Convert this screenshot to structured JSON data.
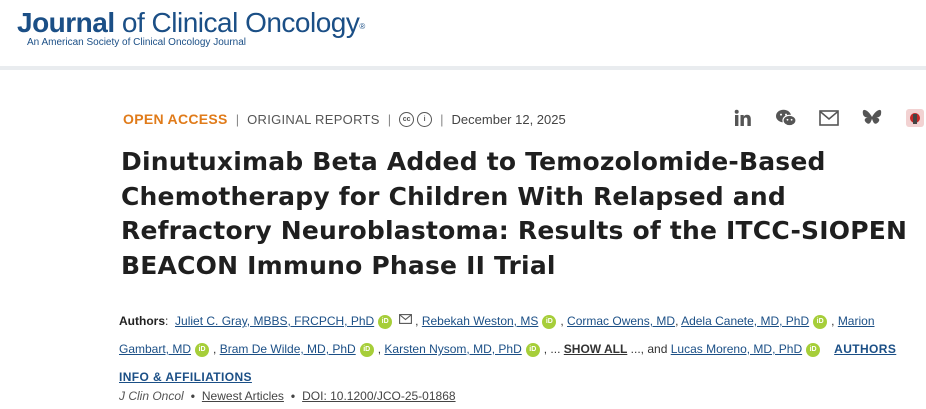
{
  "header": {
    "logo_word": "Journal",
    "logo_rest": " of Clinical Oncology",
    "logo_reg": "®",
    "logo_sub": "An American Society of Clinical Oncology Journal"
  },
  "meta": {
    "access": "OPEN ACCESS",
    "report_type": "ORIGINAL REPORTS",
    "cc_label_1": "cc",
    "cc_label_2": "i",
    "date": "December 12, 2025"
  },
  "share": {
    "icons": [
      "linkedin-icon",
      "wechat-icon",
      "email-icon",
      "bluesky-icon",
      "mendeley-icon"
    ]
  },
  "article": {
    "title": "Dinutuximab Beta Added to Temozolomide-Based Chemotherapy for Children With Relapsed and Refractory Neuroblastoma: Results of the ITCC-SIOPEN BEACON Immuno Phase II Trial"
  },
  "authors": {
    "label": "Authors",
    "colon": ":",
    "list": [
      "Juliet C. Gray, MBBS, FRCPCH, PhD",
      "Rebekah Weston, MS",
      "Cormac Owens, MD",
      "Adela Canete, MD, PhD",
      "Marion Gambart, MD",
      "Bram De Wilde, MD, PhD",
      "Karsten Nysom, MD, PhD",
      "Lucas Moreno, MD, PhD"
    ],
    "orcid_label": "iD",
    "ellipsis": ", ...",
    "show_all": "SHOW ALL",
    "and_text": "..., and",
    "info_link": "AUTHORS INFO & AFFILIATIONS"
  },
  "citation": {
    "journal": "J Clin Oncol",
    "section": "Newest Articles",
    "doi": "DOI: 10.1200/JCO-25-01868"
  }
}
